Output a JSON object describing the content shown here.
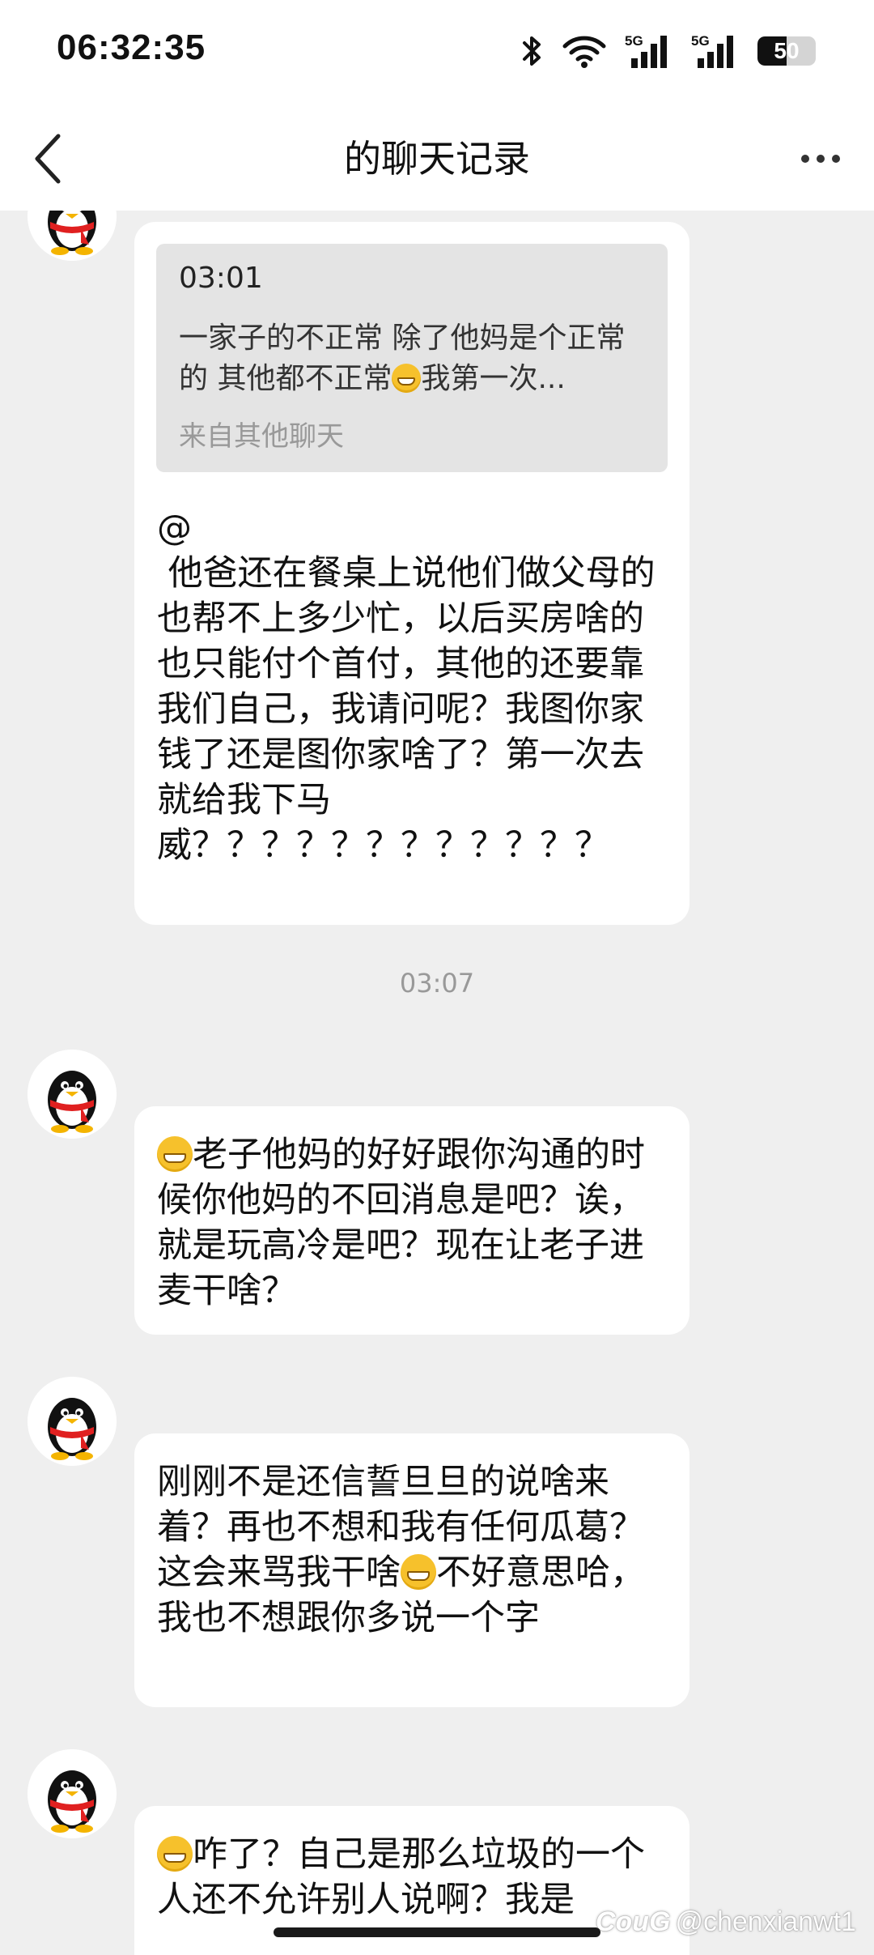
{
  "status_bar": {
    "time": "06:32:35",
    "network_label_1": "5G",
    "network_label_2": "5G",
    "battery_level": "50",
    "icons": [
      "bluetooth-icon",
      "wifi-icon",
      "signal-icon",
      "signal-icon",
      "battery-icon"
    ]
  },
  "nav": {
    "title": "的聊天记录",
    "back_icon": "chevron-left-icon",
    "more_icon": "more-horizontal-icon"
  },
  "messages": [
    {
      "sender": "",
      "quote": {
        "meta": " 03:01",
        "text_before_emoji": "一家子的不正常 除了他妈是个正常的 其他都不正常",
        "emoji": "grinning-face-emoji",
        "text_after_emoji": "我第一次...",
        "source": "来自其他聊天"
      },
      "text": "@\n 他爸还在餐桌上说他们做父母的也帮不上多少忙，以后买房啥的也只能付个首付，其他的还要靠我们自己，我请问呢？我图你家钱了还是图你家啥了？第一次去就给我下马威？？？？？？？？？？？？"
    },
    {
      "timestamp": "03:07"
    },
    {
      "sender": "",
      "emoji": "grinning-face-emoji",
      "text": "老子他妈的好好跟你沟通的时候你他妈的不回消息是吧？诶，就是玩高冷是吧？现在让老子进麦干啥？"
    },
    {
      "sender": "",
      "text_before_emoji": "刚刚不是还信誓旦旦的说啥来着？再也不想和我有任何瓜葛？这会来骂我干啥",
      "emoji": "grinning-face-emoji",
      "text_after_emoji": "不好意思哈，我也不想跟你多说一个字"
    },
    {
      "sender": "",
      "emoji": "grinning-face-emoji",
      "text": "咋了？自己是那么垃圾的一个人还不允许别人说啊？我是"
    }
  ],
  "watermark": {
    "brand": "CouG",
    "handle": "@chenxianwt1"
  },
  "colors": {
    "chat_background": "#efefef",
    "bubble": "#ffffff",
    "quote_background": "#e4e4e4",
    "muted_text": "#999999"
  }
}
